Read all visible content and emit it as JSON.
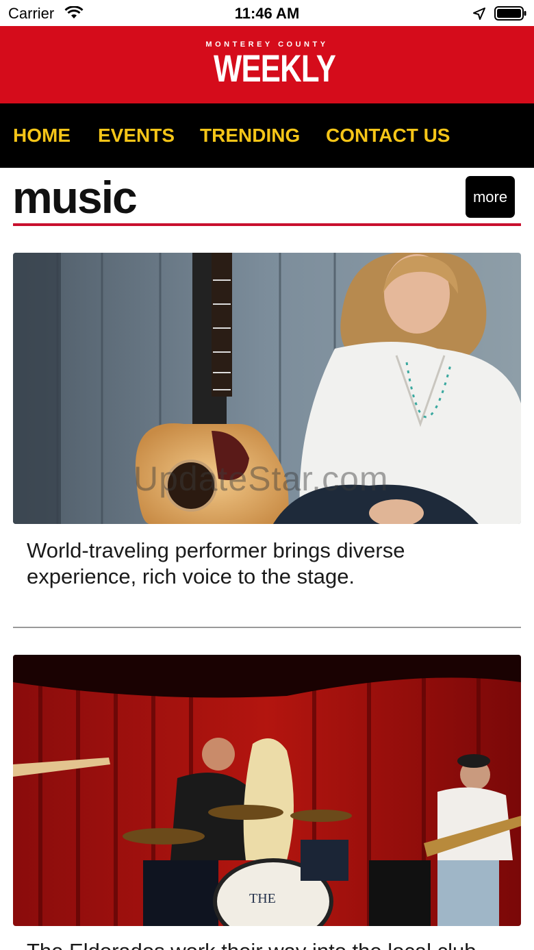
{
  "status_bar": {
    "carrier": "Carrier",
    "time": "11:46 AM"
  },
  "masthead": {
    "logo_top": "MONTEREY COUNTY",
    "logo_main": "WEEKLY",
    "color": "#d50c1b"
  },
  "nav": {
    "items": [
      {
        "label": "HOME"
      },
      {
        "label": "EVENTS"
      },
      {
        "label": "TRENDING"
      },
      {
        "label": "CONTACT US"
      }
    ],
    "text_color": "#f5c518"
  },
  "section": {
    "title": "music",
    "more_label": "more",
    "rule_color": "#c8102e"
  },
  "articles": [
    {
      "summary": "World-traveling performer brings diverse experience, rich voice to the stage.",
      "image": "guitar-and-singer-photo"
    },
    {
      "summary": "The Eldorados work their way into the local club",
      "image": "band-on-stage-photo",
      "drum_text": "THE DORADOS"
    }
  ],
  "watermark": "UpdateStar.com"
}
